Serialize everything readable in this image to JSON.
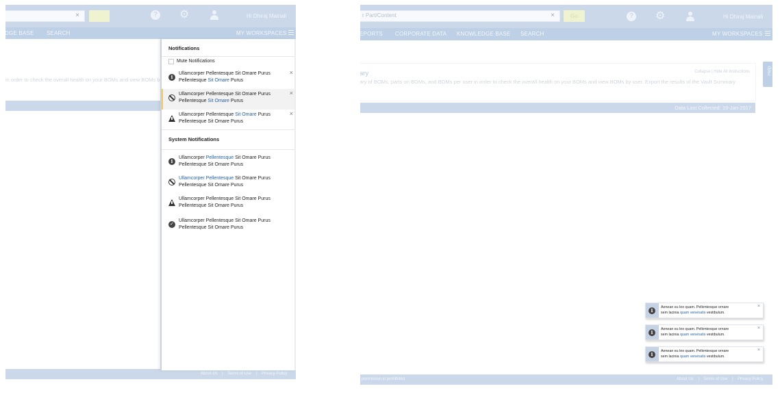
{
  "left_screen": {
    "header": {
      "search_clear": "×",
      "go_label": "",
      "greeting": "Hi Dhiraj Mainali"
    },
    "nav": {
      "items": [
        "KNOWLEDGE BASE",
        "SEARCH"
      ],
      "visible_items": [
        "DGE BASE",
        "SEARCH"
      ],
      "my_workspaces": "MY WORKSPACES"
    },
    "background_text": "in order to check the overall health on your BOMs and view BOMs b",
    "footer": {
      "about": "About Us",
      "terms": "Terms of Use",
      "privacy": "Privacy Policy",
      "sep": "|"
    },
    "notifications_panel": {
      "title": "Notifications",
      "mute_label": "Mute Notifications",
      "close_glyph": "×",
      "notifications": [
        {
          "icon": "info-icon",
          "a": "Ullamcorper Pellentesque Sit Omare Purus",
          "b": "Pellentesque ",
          "link": "Sit Omare",
          "c": " Purus",
          "highlighted": false
        },
        {
          "icon": "blocked-icon",
          "a": "Ullamcorper Pellentesque Sit Omare Purus",
          "b": "Pellentesque ",
          "link": "Sit Omare",
          "c": " Purus",
          "highlighted": true
        },
        {
          "icon": "warning-icon",
          "a1": "Ullamcorper Pellentesque ",
          "alink": "Sit Omare",
          "a2": " Purus",
          "b": "Pellentesque Sit Omare Purus",
          "highlighted": false
        }
      ],
      "system_title": "System Notifications",
      "system_notifications": [
        {
          "icon": "info-icon",
          "pre": "Ullamcorper ",
          "link": "Pellentesque",
          "post": " Sit Omare Purus",
          "b": "Pellentesque Sit Omare Purus"
        },
        {
          "icon": "blocked-icon",
          "pre": "",
          "link": "Ullamcorper Pellentesque",
          "post": " Sit Omare Purus",
          "b": "Pellentesque Sit Omare Purus"
        },
        {
          "icon": "warning-icon",
          "pre": "Ullamcorper Pellentesque Sit Omare Purus",
          "link": "",
          "post": "",
          "b": "Pellentesque Sit Omare Purus"
        },
        {
          "icon": "check-icon",
          "pre": "Ullamcorper Pellentesque Sit Omare Purus",
          "link": "",
          "post": "",
          "b": "Pellentesque Sit Omare Purus"
        }
      ]
    }
  },
  "right_screen": {
    "header": {
      "search_placeholder": "r Part/Content",
      "search_clear": "×",
      "go_label": "Go",
      "greeting": "Hi Dhiraj Mainali"
    },
    "nav": {
      "items": [
        "EPORTS",
        "CORPORATE DATA",
        "KNOWLEDGE BASE",
        "SEARCH"
      ],
      "my_workspaces": "MY WORKSPACES"
    },
    "help_tab": "Help",
    "summary_card": {
      "title": "ary",
      "links": "Collapse | Hide All Instructions",
      "text": "ary of BOMs, parts on BOMs, and BOMs per user in order to check the overall health on your BOMs and view BOMs by user. Export the results of the Vault Summary"
    },
    "data_bar": "Data Last Collected: 19-Jan-2017",
    "footer": {
      "left_text": "permission is prohibited.",
      "about": "About Us",
      "terms": "Terms of Use",
      "privacy": "Privacy Policy",
      "sep": "|"
    },
    "toasts": [
      {
        "icon": "info-icon",
        "line1": "Aenean eu leo quam. Pellentesque ornare",
        "pre": "sem lacinia ",
        "link": "quam venenatis",
        "post": " vestibulum.",
        "close": "×"
      },
      {
        "icon": "info-icon",
        "line1": "Aenean eu leo quam. Pellentesque ornare",
        "pre": "sem lacinia ",
        "link": "quam venenatis",
        "post": " vestibulum.",
        "close": "×"
      },
      {
        "icon": "info-icon",
        "line1": "Aenean eu leo quam. Pellentesque ornare",
        "pre": "sem lacinia ",
        "link": "quam venenatis",
        "post": " vestibulum.",
        "close": "×"
      }
    ]
  },
  "colors": {
    "header_bg": "#cad8ea",
    "nav_bg": "#bdd0e6",
    "link": "#2460a7",
    "highlight_border": "#f0c866"
  }
}
